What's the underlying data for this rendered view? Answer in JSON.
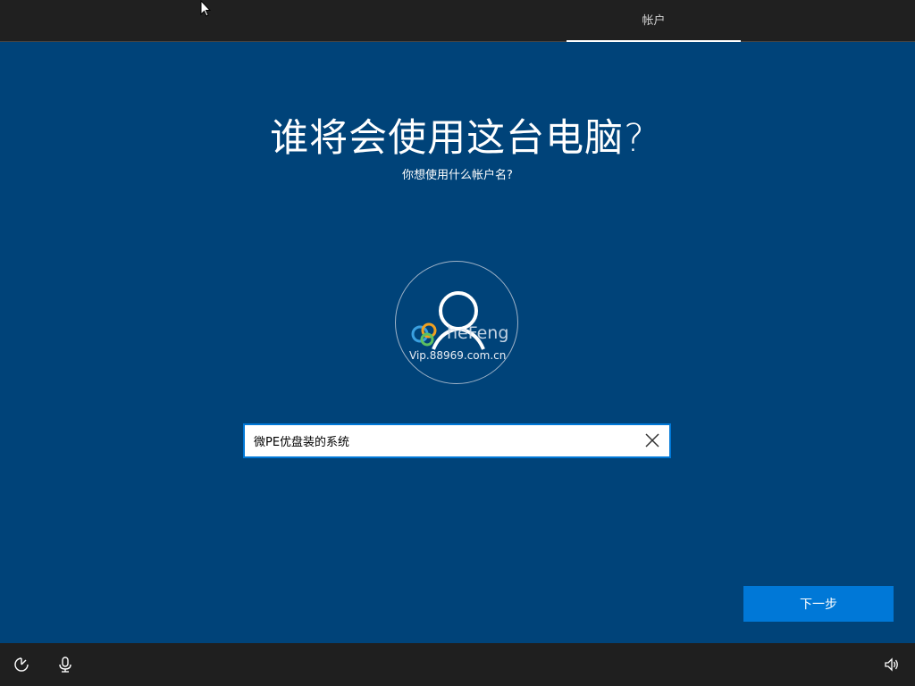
{
  "header": {
    "tab_account": "帐户"
  },
  "main": {
    "title": "谁将会使用这台电脑?",
    "subtitle": "你想使用什么帐户名?",
    "watermark_text": "heFeng",
    "watermark_url": "Vip.88969.com.cn"
  },
  "form": {
    "name_value": "微PE优盘装的系统"
  },
  "actions": {
    "next_label": "下一步"
  },
  "bottom_bar": {
    "left_icons": [
      "ease-of-access-icon",
      "microphone-icon"
    ],
    "right_icons": [
      "volume-icon"
    ]
  },
  "colors": {
    "background": "#004379",
    "accent": "#0078d7",
    "top_bar": "#202020",
    "bottom_bar": "#1f1f1f"
  }
}
